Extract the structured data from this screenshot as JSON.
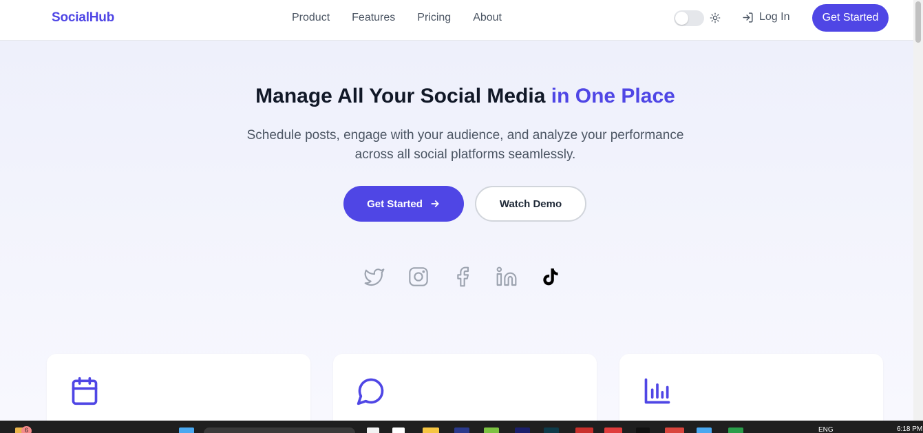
{
  "nav": {
    "logo": "SocialHub",
    "links": [
      "Product",
      "Features",
      "Pricing",
      "About"
    ],
    "login": "Log In",
    "cta": "Get Started"
  },
  "hero": {
    "title_main": "Manage All Your Social Media ",
    "title_accent": "in One Place",
    "subtitle": "Schedule posts, engage with your audience, and analyze your performance across all social platforms seamlessly.",
    "primary_button": "Get Started",
    "secondary_button": "Watch Demo"
  },
  "social_icons": [
    "twitter-icon",
    "instagram-icon",
    "facebook-icon",
    "linkedin-icon",
    "tiktok-icon"
  ],
  "feature_icons": [
    "calendar-icon",
    "message-circle-icon",
    "bar-chart-icon"
  ],
  "taskbar": {
    "notification_count": "6",
    "language": "ENG",
    "time": "6:18 PM"
  },
  "colors": {
    "brand": "#4f46e5",
    "text_dark": "#111827",
    "text_muted": "#4b5563",
    "icon_gray": "#9ca3af"
  }
}
